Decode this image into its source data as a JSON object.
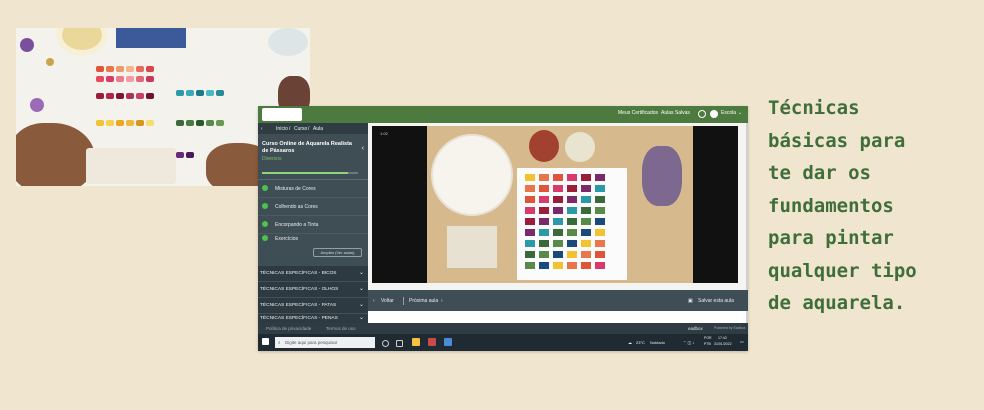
{
  "headline": "Técnicas\nbásicas para\nte dar os\nfundamentos\npara pintar\nqualquer tipo\nde aquarela.",
  "screen": {
    "topbar": {
      "links": [
        "Meus Certificados",
        "Aulas Salvas"
      ],
      "user": "Escola"
    },
    "breadcrumb": [
      "Início",
      "Curso",
      "Aula"
    ],
    "course": {
      "title": "Curso Online de Aquarela Realista de Pássaros",
      "subtitle": "Diversos"
    },
    "lessons": [
      "Misturas de Cores",
      "Colhendo as Cores",
      "Encorpando a Tinta",
      "Exercícios"
    ],
    "more_button": "Ampliar (Ver aulas)",
    "sections": [
      "TÉCNICAS ESPECÍFICAS - BICOS",
      "TÉCNICAS ESPECÍFICAS - OLHOS",
      "TÉCNICAS ESPECÍFICAS - PATAS",
      "TÉCNICAS ESPECÍFICAS - PENAS"
    ],
    "video": {
      "time": "1:02"
    },
    "controls": {
      "prev": "Voltar",
      "next": "Próxima aula",
      "save": "Salvar esta aula"
    },
    "footer": {
      "links": [
        "Política de privacidade",
        "Termos de uso"
      ],
      "brand": "eadbox",
      "powered": "Powered by Eadbox"
    },
    "taskbar": {
      "search_placeholder": "Digite aqui para pesquisar",
      "weather_temp": "23°C",
      "weather_text": "Nublado",
      "lang": "POR",
      "layout": "PTB",
      "time": "17:43",
      "date": "31/01/2022"
    }
  },
  "colors": {
    "accent_green": "#4d7a3f",
    "headline_green": "#3f6e3a",
    "sidebar": "#3f4d55",
    "background": "#f0e6cf"
  }
}
